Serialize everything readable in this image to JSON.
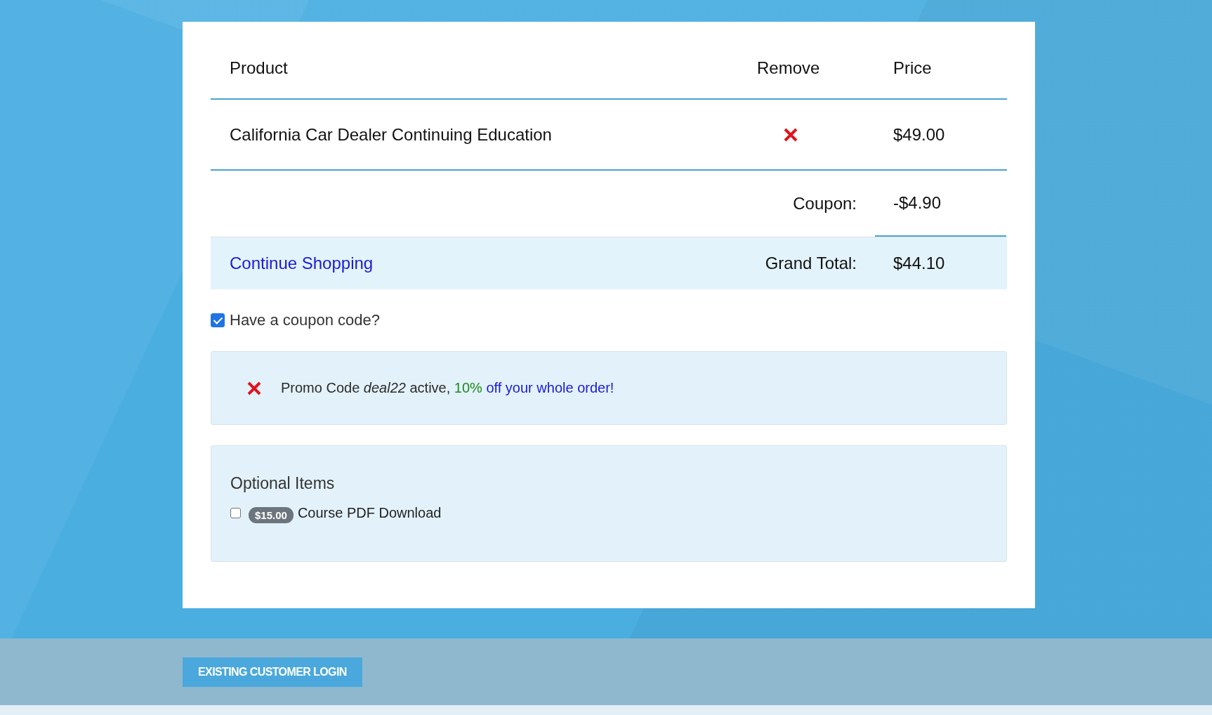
{
  "cart": {
    "columns": [
      "Product",
      "Remove",
      "Price"
    ],
    "items": [
      {
        "product": "California Car Dealer Continuing Education",
        "price": "$49.00"
      }
    ],
    "coupon": {
      "label": "Coupon:",
      "value": "-$4.90"
    },
    "total": {
      "link": "Continue Shopping",
      "label": "Grand Total:",
      "value": "$44.10"
    }
  },
  "coupon_toggle": {
    "label": "Have a coupon code?",
    "checked": true
  },
  "promo": {
    "message": "Promo Code *deal22* active,",
    "discount": "10%",
    "offer": "off your whole order!"
  },
  "optional_items": {
    "title": "Optional Items",
    "items": [
      {
        "price": "$15.00",
        "label": "Course PDF Download",
        "checked": false
      }
    ]
  },
  "footer": {
    "login_button": "EXISTING CUSTOMER LOGIN"
  }
}
